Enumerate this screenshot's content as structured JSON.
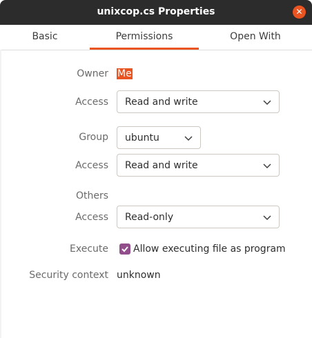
{
  "window": {
    "title": "unixcop.cs Properties",
    "close_icon": "close-icon"
  },
  "tabs": [
    {
      "label": "Basic",
      "active": false
    },
    {
      "label": "Permissions",
      "active": true
    },
    {
      "label": "Open With",
      "active": false
    }
  ],
  "permissions": {
    "owner_label": "Owner",
    "owner_value": "Me",
    "owner_access_label": "Access",
    "owner_access_value": "Read and write",
    "group_label": "Group",
    "group_value": "ubuntu",
    "group_access_label": "Access",
    "group_access_value": "Read and write",
    "others_label": "Others",
    "others_access_label": "Access",
    "others_access_value": "Read-only",
    "execute_label": "Execute",
    "execute_checkbox_label": "Allow executing file as program",
    "execute_checked": true,
    "security_context_label": "Security context",
    "security_context_value": "unknown"
  },
  "colors": {
    "accent": "#e95420",
    "checkbox": "#924d8b",
    "titlebar": "#2c2c2c"
  }
}
